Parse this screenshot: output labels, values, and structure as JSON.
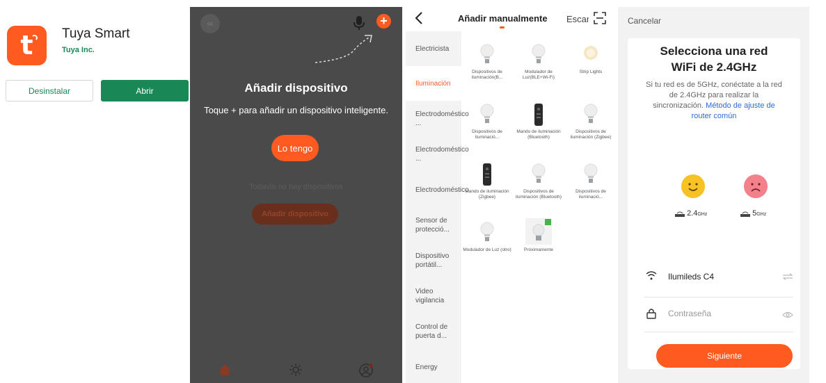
{
  "store": {
    "app_name": "Tuya Smart",
    "developer": "Tuya Inc.",
    "uninstall_label": "Desinstalar",
    "open_label": "Abrir",
    "icon": "tuya-logo-icon",
    "brand_color": "#ff5a1f",
    "accent_color": "#1a8756"
  },
  "onboarding": {
    "title": "Añadir dispositivo",
    "subtitle": "Toque + para añadir un dispositivo inteligente.",
    "have_it_label": "Lo tengo",
    "empty_text": "Todavía no hay dispositivos",
    "add_device_label": "Añadir dispositivo",
    "background": "#4a4a4a"
  },
  "add_manual": {
    "title": "Añadir manualmente",
    "scan_label": "Escanear",
    "categories": [
      {
        "label": "Electricista"
      },
      {
        "label": "Iluminación"
      },
      {
        "label": "Electrodoméstico ..."
      },
      {
        "label": "Electrodoméstico ..."
      },
      {
        "label": "Electrodoméstico"
      },
      {
        "label": "Sensor de protecció..."
      },
      {
        "label": "Dispositivo portátil..."
      },
      {
        "label": "Video vigilancia"
      },
      {
        "label": "Control de puerta d..."
      },
      {
        "label": "Energy"
      }
    ],
    "devices": [
      {
        "label": "Dispositivos de iluminación(B..."
      },
      {
        "label": "Modulador de Luz(BLE+Wi-Fi)"
      },
      {
        "label": "Strip Lights"
      },
      {
        "label": "Dispositivos de iluminació..."
      },
      {
        "label": "Mando de iluminación (Bluetooth)"
      },
      {
        "label": "Dispositivos de iluminación (Zigbee)"
      },
      {
        "label": "Mando de iluminación (Zigbee)"
      },
      {
        "label": "Dispositivos de iluminación (Bluetooth)"
      },
      {
        "label": "Dispositivos de iluminació..."
      },
      {
        "label": "Modulador de Luz (otro)"
      },
      {
        "label": "Próximamente"
      }
    ]
  },
  "wifi": {
    "cancel_label": "Cancelar",
    "title": "Selecciona una red WiFi de 2.4GHz",
    "desc": "Si tu red es de 5GHz, conéctate a la red de 2.4GHz para realizar la sincronización.",
    "link": "Método de ajuste de router común",
    "band_ok_value": "2.4",
    "band_ok_unit": "GHz",
    "band_bad_value": "5",
    "band_bad_unit": "GHz",
    "ssid": "Ilumileds C4",
    "password_placeholder": "Contraseña",
    "next_label": "Siguiente"
  }
}
